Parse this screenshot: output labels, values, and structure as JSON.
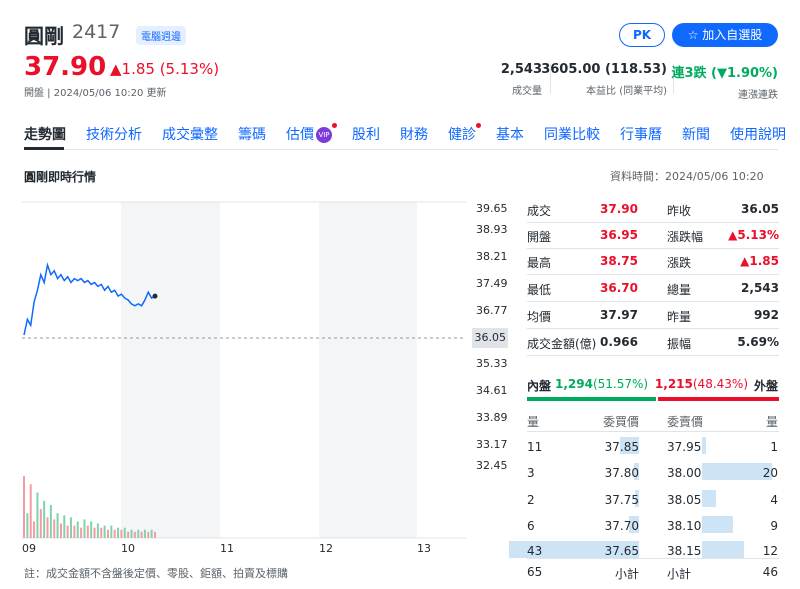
{
  "header": {
    "name": "圓剛",
    "code": "2417",
    "badge": "電腦週邊",
    "price": "37.90",
    "change": "▲1.85 (5.13%)",
    "meta": "開盤 | 2024/05/06 10:20 更新",
    "pk_label": "PK",
    "follow_label": "加入自選股"
  },
  "stats": [
    {
      "value": "2,543",
      "label": "成交量"
    },
    {
      "value": "3605.00 (118.53)",
      "label": "本益比 (同業平均)"
    },
    {
      "value_a": "連3跌",
      "value_b": "(▼1.90%)",
      "label": "連漲連跌"
    }
  ],
  "tabs": [
    "走勢圖",
    "技術分析",
    "成交彙整",
    "籌碼",
    "估價",
    "股利",
    "財務",
    "健診",
    "基本",
    "同業比較",
    "行事曆",
    "新聞",
    "使用說明"
  ],
  "vip_label": "VIP",
  "section": {
    "title": "圓剛即時行情",
    "time": "資料時間：2024/05/06 10:20"
  },
  "chart_data": {
    "type": "line",
    "y_ticks": [
      "39.65",
      "38.93",
      "38.21",
      "37.49",
      "36.77",
      "36.05",
      "35.33",
      "34.61",
      "33.89",
      "33.17",
      "32.45"
    ],
    "x_ticks": [
      "09",
      "10",
      "11",
      "12",
      "13"
    ],
    "ref_price": "36.05",
    "ylim": [
      31.73,
      40.37
    ],
    "price_series": [
      36.95,
      37.35,
      37.2,
      37.8,
      38.1,
      38.5,
      38.3,
      38.75,
      38.5,
      38.6,
      38.4,
      38.5,
      38.35,
      38.45,
      38.3,
      38.4,
      38.35,
      38.4,
      38.3,
      38.35,
      38.25,
      38.3,
      38.2,
      38.25,
      38.1,
      38.2,
      38.05,
      38.1,
      37.95,
      38.0,
      37.9,
      37.85,
      37.75,
      37.7,
      37.75,
      37.7,
      37.85,
      38.05,
      37.9,
      37.95
    ],
    "volume_series": [
      30,
      12,
      26,
      8,
      22,
      14,
      18,
      10,
      16,
      9,
      12,
      7,
      11,
      6,
      10,
      6,
      8,
      5,
      9,
      6,
      8,
      5,
      7,
      5,
      6,
      4,
      6,
      4,
      5,
      4,
      5,
      3,
      4,
      3,
      4,
      3,
      4,
      3,
      4,
      3
    ],
    "volume_up": [
      true,
      false,
      true,
      true,
      false,
      true,
      false,
      true,
      false,
      true,
      false,
      true,
      false,
      true,
      false,
      true,
      false,
      true,
      false,
      true,
      false,
      true,
      false,
      true,
      false,
      true,
      false,
      true,
      false,
      true,
      false,
      true,
      false,
      true,
      false,
      true,
      false,
      true,
      false,
      true
    ]
  },
  "quote": [
    {
      "l1": "成交",
      "v1": "37.90",
      "c1": "red",
      "l2": "昨收",
      "v2": "36.05",
      "c2": ""
    },
    {
      "l1": "開盤",
      "v1": "36.95",
      "c1": "red",
      "l2": "漲跌幅",
      "v2": "▲5.13%",
      "c2": "red"
    },
    {
      "l1": "最高",
      "v1": "38.75",
      "c1": "red",
      "l2": "漲跌",
      "v2": "▲1.85",
      "c2": "red"
    },
    {
      "l1": "最低",
      "v1": "36.70",
      "c1": "red",
      "l2": "總量",
      "v2": "2,543",
      "c2": ""
    },
    {
      "l1": "均價",
      "v1": "37.97",
      "c1": "",
      "l2": "昨量",
      "v2": "992",
      "c2": ""
    },
    {
      "l1": "成交金額(億)",
      "v1": "0.966",
      "c1": "",
      "l2": "振幅",
      "v2": "5.69%",
      "c2": ""
    }
  ],
  "inout": {
    "in_label": "內盤",
    "in_value": "1,294",
    "in_pct": "(51.57%)",
    "out_value": "1,215",
    "out_pct": "(48.43%)",
    "out_label": "外盤",
    "in_fraction": 0.5157
  },
  "orderbook": {
    "headers": [
      "量",
      "委買價",
      "委賣價",
      "量"
    ],
    "bids": [
      {
        "qty": "11",
        "price": "37.85",
        "level": 0.26
      },
      {
        "qty": "3",
        "price": "37.80",
        "level": 0.07
      },
      {
        "qty": "2",
        "price": "37.75",
        "level": 0.05
      },
      {
        "qty": "6",
        "price": "37.70",
        "level": 0.14
      },
      {
        "qty": "43",
        "price": "37.65",
        "level": 1.0
      }
    ],
    "asks": [
      {
        "qty": "1",
        "price": "37.95",
        "level": 0.05
      },
      {
        "qty": "20",
        "price": "38.00",
        "level": 1.0
      },
      {
        "qty": "4",
        "price": "38.05",
        "level": 0.2
      },
      {
        "qty": "9",
        "price": "38.10",
        "level": 0.45
      },
      {
        "qty": "12",
        "price": "38.15",
        "level": 0.6
      }
    ],
    "bid_total": "65",
    "ask_total": "46",
    "subtotal_label": "小計"
  },
  "note": "註：成交金額不含盤後定價、零股、鉅額、拍賣及標購"
}
